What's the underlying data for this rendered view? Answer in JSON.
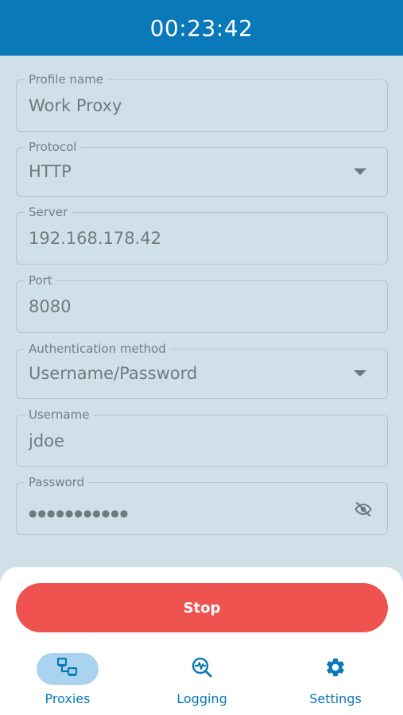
{
  "header": {
    "timer": "00:23:42"
  },
  "form": {
    "profile_name": {
      "label": "Profile name",
      "value": "Work Proxy"
    },
    "protocol": {
      "label": "Protocol",
      "value": "HTTP"
    },
    "server": {
      "label": "Server",
      "value": "192.168.178.42"
    },
    "port": {
      "label": "Port",
      "value": "8080"
    },
    "auth_method": {
      "label": "Authentication method",
      "value": "Username/Password"
    },
    "username": {
      "label": "Username",
      "value": "jdoe"
    },
    "password": {
      "label": "Password",
      "value": "●●●●●●●●●●●",
      "icon": "eye-off-icon"
    }
  },
  "actions": {
    "stop_label": "Stop"
  },
  "nav": {
    "items": [
      {
        "label": "Proxies",
        "icon": "proxies-icon",
        "active": true
      },
      {
        "label": "Logging",
        "icon": "logging-icon",
        "active": false
      },
      {
        "label": "Settings",
        "icon": "settings-icon",
        "active": false
      }
    ]
  },
  "colors": {
    "header_bg": "#0a79b9",
    "form_bg": "#cfe0e8",
    "stop_button": "#ef5350",
    "nav_active_pill": "#a9d3ee",
    "nav_text": "#0a79b9"
  }
}
